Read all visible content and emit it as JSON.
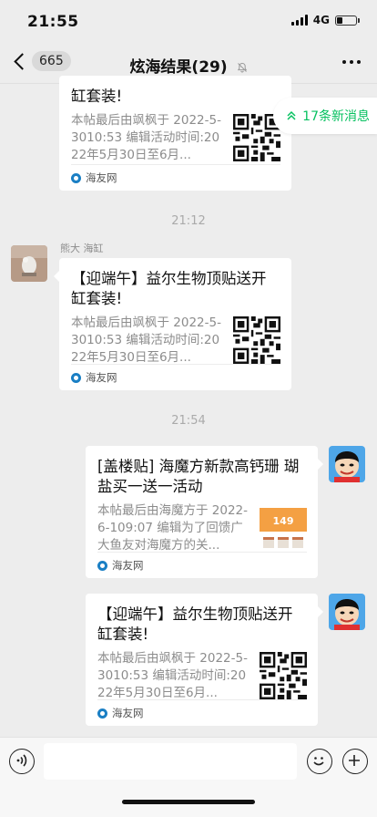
{
  "status": {
    "time": "21:55",
    "network": "4G",
    "battery_level": 0.25
  },
  "nav": {
    "back_count": "665",
    "title": "炫海结果(29)"
  },
  "new_messages": {
    "label": "17条新消息"
  },
  "messages": [
    {
      "title": "缸套装!",
      "desc": "本帖最后由飒枫于 2022-5-3010:53 编辑活动时间:2022年5月30日至6月...",
      "source": "海友网",
      "thumb": "qr-code"
    },
    {
      "time": "21:12"
    },
    {
      "sender": "熊大 海缸",
      "title": "【迎端午】益尔生物顶贴送开缸套装!",
      "desc": "本帖最后由飒枫于 2022-5-3010:53 编辑活动时间:2022年5月30日至6月...",
      "source": "海友网",
      "thumb": "qr-code"
    },
    {
      "time": "21:54"
    },
    {
      "title": "[盖楼贴] 海魔方新款高钙珊 瑚盐买一送一活动",
      "desc": "本帖最后由海魔方于 2022-6-109:07 编辑为了回馈广大鱼友对海魔方的关...",
      "source": "海友网",
      "thumb": "product-image",
      "thumb_text": "149"
    },
    {
      "title": "【迎端午】益尔生物顶贴送开缸套装!",
      "desc": "本帖最后由飒枫于 2022-5-3010:53 编辑活动时间:2022年5月30日至6月...",
      "source": "海友网",
      "thumb": "qr-code"
    }
  ]
}
